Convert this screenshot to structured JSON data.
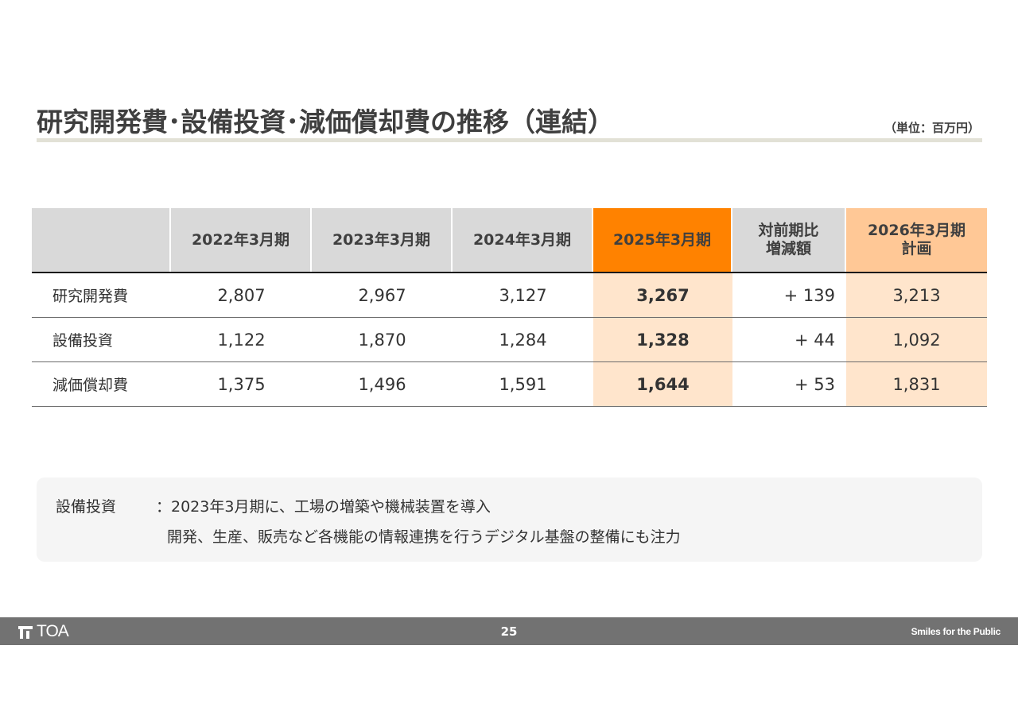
{
  "header": {
    "title": "研究開発費･設備投資･減価償却費の推移（連結）",
    "unit": "（単位：百万円）"
  },
  "table": {
    "columns": [
      {
        "label": ""
      },
      {
        "label": "2022年3月期"
      },
      {
        "label": "2023年3月期"
      },
      {
        "label": "2024年3月期"
      },
      {
        "label": "2025年3月期"
      },
      {
        "label_line1": "対前期比",
        "label_line2": "増減額"
      },
      {
        "label_line1": "2026年3月期",
        "label_line2": "計画"
      }
    ],
    "rows": [
      {
        "label": "研究開発費",
        "values": [
          "2,807",
          "2,967",
          "3,127",
          "3,267",
          "+ 139",
          "3,213"
        ]
      },
      {
        "label": "設備投資",
        "values": [
          "1,122",
          "1,870",
          "1,284",
          "1,328",
          "+ 44",
          "1,092"
        ]
      },
      {
        "label": "減価償却費",
        "values": [
          "1,375",
          "1,496",
          "1,591",
          "1,644",
          "+ 53",
          "1,831"
        ]
      }
    ],
    "colors": {
      "header_gray": "#d9d9d9",
      "highlight_orange": "#ff8200",
      "plan_header": "#ffc896",
      "highlight_light": "#ffe5cc"
    }
  },
  "note": {
    "label": "設備投資",
    "line1": "：2023年3月期に、工場の増築や機械装置を導入",
    "line2": "開発、生産、販売など各機能の情報連携を行うデジタル基盤の整備にも注力"
  },
  "footer": {
    "logo_text": "TOA",
    "logo_icon": "toa-logo-icon",
    "page_number": "25",
    "tagline": "Smiles for the Public"
  }
}
